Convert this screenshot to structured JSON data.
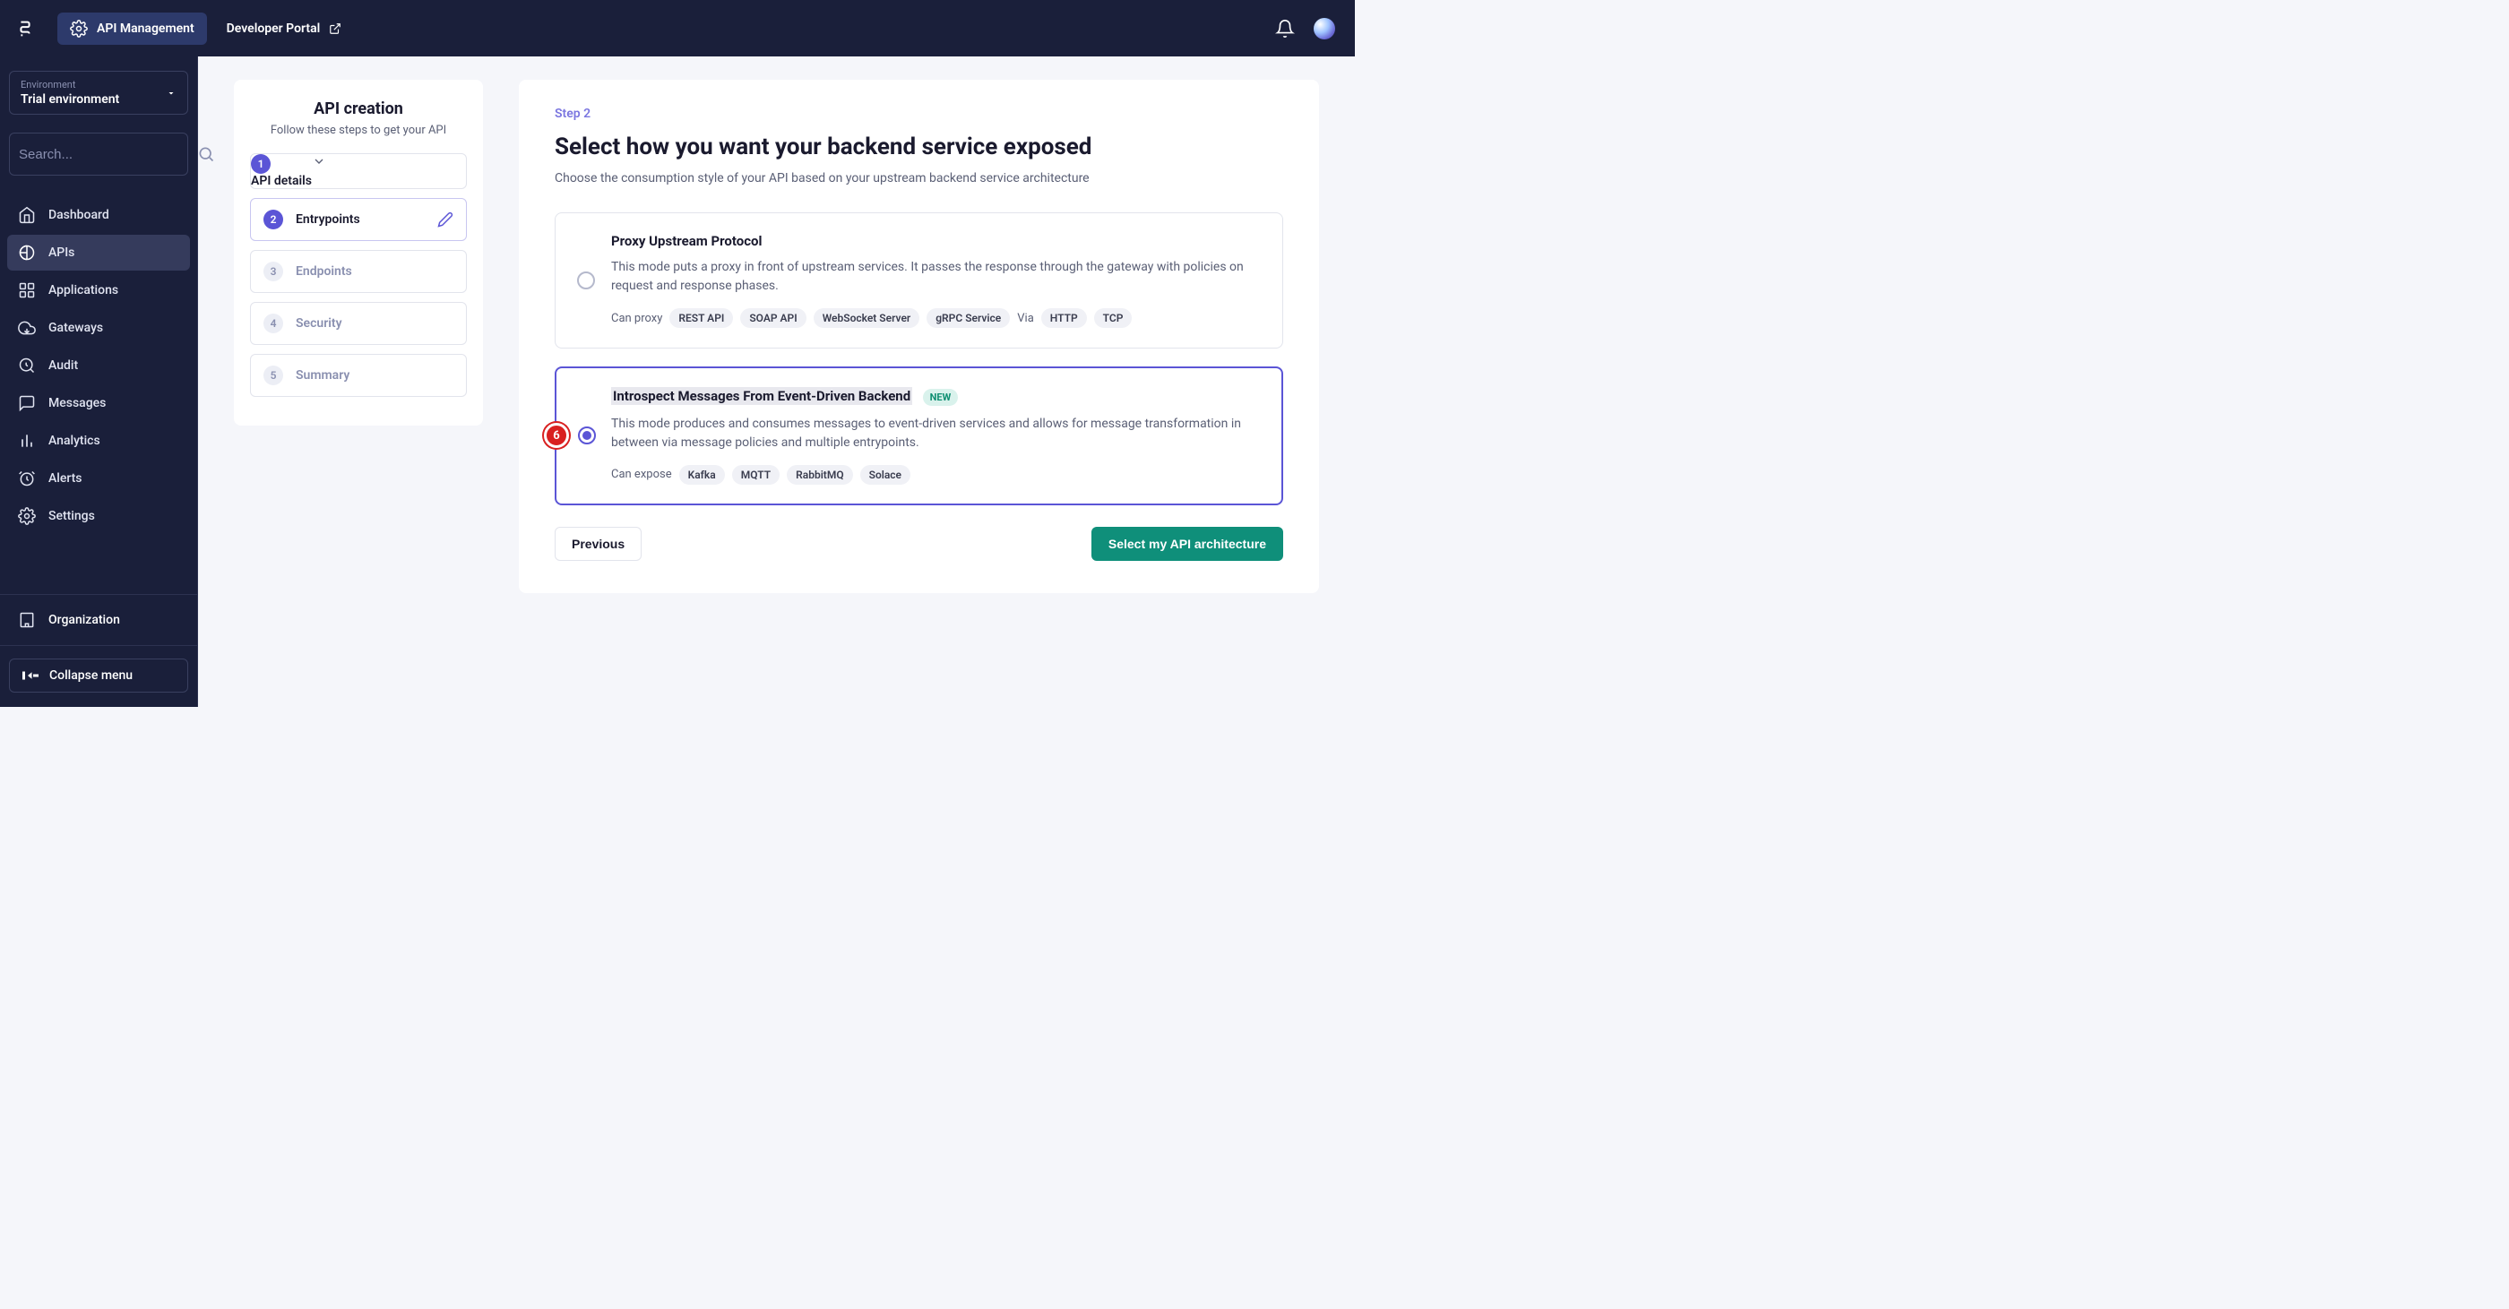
{
  "topbar": {
    "api_mgmt_label": "API Management",
    "dev_portal_label": "Developer Portal"
  },
  "sidebar": {
    "env_label": "Environment",
    "env_value": "Trial environment",
    "search_placeholder": "Search...",
    "items": [
      {
        "label": "Dashboard",
        "icon": "home"
      },
      {
        "label": "APIs",
        "icon": "api"
      },
      {
        "label": "Applications",
        "icon": "apps"
      },
      {
        "label": "Gateways",
        "icon": "cloud"
      },
      {
        "label": "Audit",
        "icon": "audit"
      },
      {
        "label": "Messages",
        "icon": "messages"
      },
      {
        "label": "Analytics",
        "icon": "analytics"
      },
      {
        "label": "Alerts",
        "icon": "alerts"
      },
      {
        "label": "Settings",
        "icon": "settings"
      }
    ],
    "organization_label": "Organization",
    "collapse_label": "Collapse menu"
  },
  "stepper": {
    "title": "API creation",
    "subtitle": "Follow these steps to get your API",
    "steps": [
      {
        "num": "1",
        "label": "API details"
      },
      {
        "num": "2",
        "label": "Entrypoints"
      },
      {
        "num": "3",
        "label": "Endpoints"
      },
      {
        "num": "4",
        "label": "Security"
      },
      {
        "num": "5",
        "label": "Summary"
      }
    ]
  },
  "content": {
    "step_indicator": "Step 2",
    "title": "Select how you want your backend service exposed",
    "description": "Choose the consumption style of your API based on your upstream backend service architecture",
    "options": [
      {
        "title": "Proxy Upstream Protocol",
        "description": "This mode puts a proxy in front of upstream services. It passes the response through the gateway with policies on request and response phases.",
        "lead": "Can proxy",
        "tags": [
          "REST API",
          "SOAP API",
          "WebSocket Server",
          "gRPC Service"
        ],
        "mid": "Via",
        "tags2": [
          "HTTP",
          "TCP"
        ]
      },
      {
        "title": "Introspect Messages From Event-Driven Backend",
        "new_label": "NEW",
        "description": "This mode produces and consumes messages to event-driven services and allows for message transformation in between via message policies and multiple entrypoints.",
        "lead": "Can expose",
        "tags": [
          "Kafka",
          "MQTT",
          "RabbitMQ",
          "Solace"
        ]
      }
    ],
    "marker": "6",
    "prev_label": "Previous",
    "next_label": "Select my API architecture"
  }
}
